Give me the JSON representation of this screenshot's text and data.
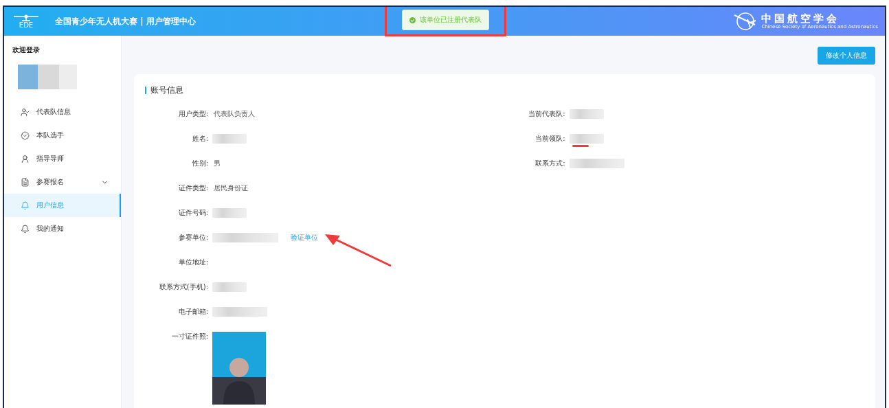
{
  "header": {
    "logo_text": "EDE",
    "title": "全国青少年无人机大赛 | 用户管理中心",
    "toast": {
      "text": "该单位已注册代表队",
      "highlighted": true
    },
    "org": {
      "name": "中国航空学会",
      "subtitle": "Chinese Society of Aeronautics and Astronautics"
    }
  },
  "sidebar": {
    "welcome": "欢迎登录",
    "items": [
      {
        "label": "代表队信息",
        "selected": false,
        "expandable": false
      },
      {
        "label": "本队选手",
        "selected": false,
        "expandable": false
      },
      {
        "label": "指导导师",
        "selected": false,
        "expandable": false
      },
      {
        "label": "参赛报名",
        "selected": false,
        "expandable": true
      },
      {
        "label": "用户信息",
        "selected": true,
        "expandable": false
      },
      {
        "label": "我的通知",
        "selected": false,
        "expandable": false
      }
    ]
  },
  "edit_button": "修改个人信息",
  "section_title": "账号信息",
  "left_fields": [
    {
      "label": "用户类型:",
      "kind": "text",
      "value": "代表队负责人"
    },
    {
      "label": "姓名:",
      "kind": "redacted"
    },
    {
      "label": "性别:",
      "kind": "text",
      "value": "男"
    },
    {
      "label": "证件类型:",
      "kind": "text",
      "value": "居民身份证"
    },
    {
      "label": "证件号码:",
      "kind": "redacted"
    },
    {
      "label": "参赛单位:",
      "kind": "redacted_link",
      "link": "验证单位",
      "arrow_marked": true
    },
    {
      "label": "单位地址:",
      "kind": "empty"
    },
    {
      "label": "联系方式(手机):",
      "kind": "redacted"
    },
    {
      "label": "电子邮箱:",
      "kind": "redacted"
    },
    {
      "label": "一寸证件照:",
      "kind": "photo"
    }
  ],
  "right_fields": [
    {
      "label": "当前代表队:",
      "kind": "redacted",
      "underlined": false
    },
    {
      "label": "当前领队:",
      "kind": "redacted",
      "underlined": true
    },
    {
      "label": "联系方式:",
      "kind": "redacted",
      "underlined": false
    }
  ]
}
